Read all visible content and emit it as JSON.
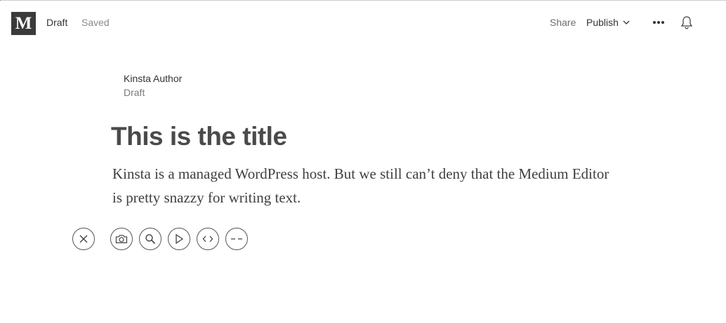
{
  "header": {
    "logo_letter": "M",
    "status": "Draft",
    "save_state": "Saved",
    "share_label": "Share",
    "publish_label": "Publish"
  },
  "author": {
    "name": "Kinsta Author",
    "status": "Draft"
  },
  "post": {
    "title": "This is the title",
    "body": "Kinsta is a managed WordPress host. But we still can’t deny that the Medium Editor is pretty snazzy for writing text."
  },
  "insert_toolbar": {
    "buttons": [
      {
        "icon": "close-icon"
      },
      {
        "icon": "camera-icon"
      },
      {
        "icon": "search-icon"
      },
      {
        "icon": "play-icon"
      },
      {
        "icon": "code-icon"
      },
      {
        "icon": "divider-icon"
      }
    ]
  },
  "colors": {
    "logo_bg": "#3a3a3a",
    "text": "#333333",
    "muted": "#8a8a8a",
    "title": "#4a4a4a"
  }
}
